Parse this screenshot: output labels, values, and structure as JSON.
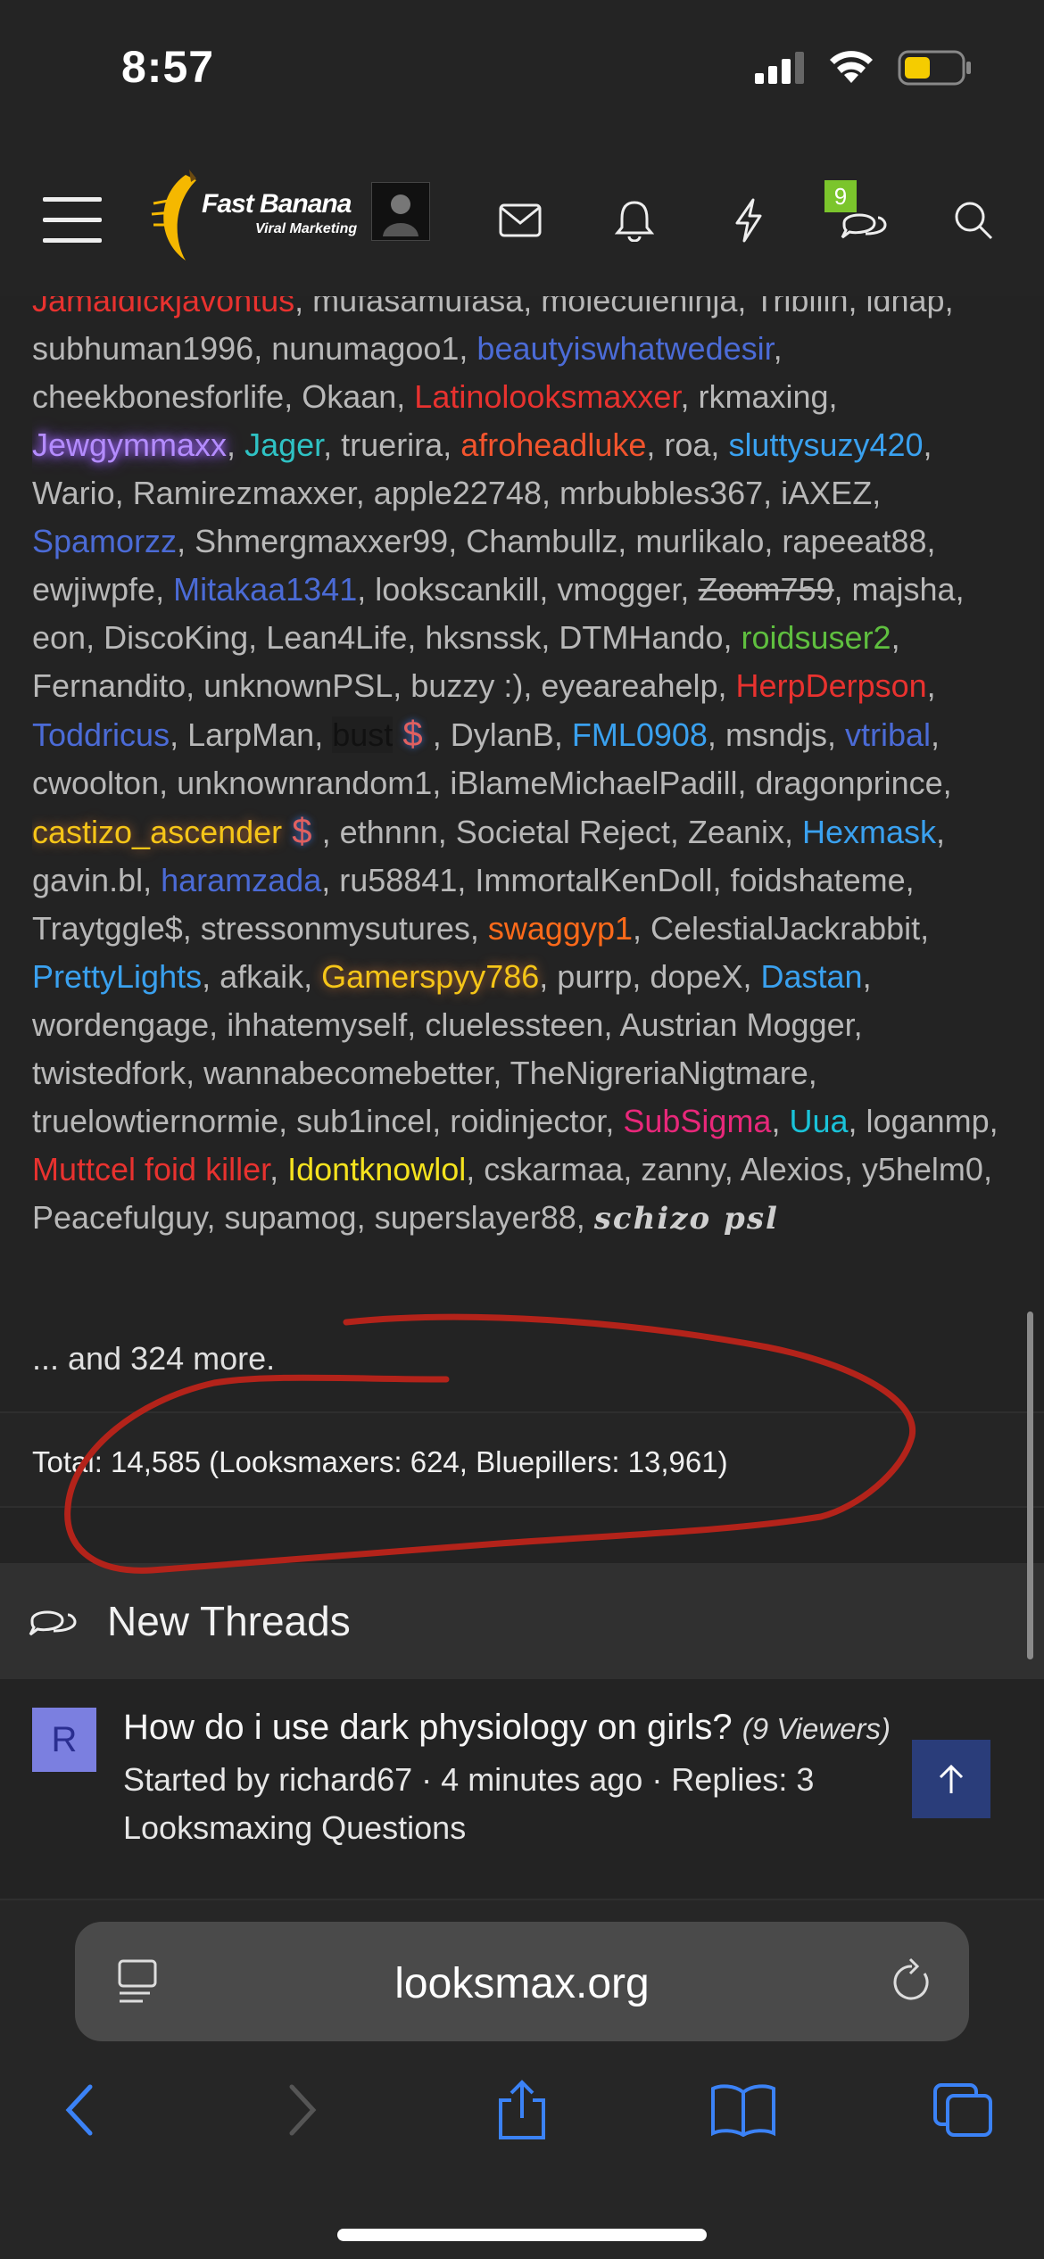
{
  "status_bar": {
    "time": "8:57"
  },
  "nav": {
    "logo_text": "Fast Banana",
    "logo_sub": "Viral Marketing",
    "chat_badge": "9"
  },
  "online": {
    "names": [
      {
        "t": "Jamaldickjavontus",
        "c": "red"
      },
      {
        "t": "mufasamufasa",
        "c": ""
      },
      {
        "t": "moleculeninja",
        "c": ""
      },
      {
        "t": "Tribilin",
        "c": ""
      },
      {
        "t": "idnap",
        "c": ""
      },
      {
        "t": "subhuman1996",
        "c": ""
      },
      {
        "t": "nunumagoo1",
        "c": ""
      },
      {
        "t": "beautyiswhatwedesir",
        "c": "blue"
      },
      {
        "t": "cheekbonesforlife",
        "c": ""
      },
      {
        "t": "Okaan",
        "c": ""
      },
      {
        "t": "Latinolooksmaxxer",
        "c": "red"
      },
      {
        "t": "rkmaxing",
        "c": ""
      },
      {
        "t": "Jewgymmaxx",
        "c": "purple"
      },
      {
        "t": "Jager",
        "c": "cyan"
      },
      {
        "t": "truerira",
        "c": ""
      },
      {
        "t": "afroheadluke",
        "c": "orangered"
      },
      {
        "t": "roa",
        "c": ""
      },
      {
        "t": "sluttysuzy420",
        "c": "sky"
      },
      {
        "t": "Wario",
        "c": ""
      },
      {
        "t": "Ramirezmaxxer",
        "c": ""
      },
      {
        "t": "apple22748",
        "c": ""
      },
      {
        "t": "mrbubbles367",
        "c": ""
      },
      {
        "t": "iAXEZ",
        "c": ""
      },
      {
        "t": "Spamorzz",
        "c": "blue"
      },
      {
        "t": "Shmergmaxxer99",
        "c": ""
      },
      {
        "t": "Chambullz",
        "c": ""
      },
      {
        "t": "murlikalo",
        "c": ""
      },
      {
        "t": "rapeeat88",
        "c": ""
      },
      {
        "t": "ewjiwpfe",
        "c": ""
      },
      {
        "t": "Mitakaa1341",
        "c": "blue"
      },
      {
        "t": "lookscankill",
        "c": ""
      },
      {
        "t": "vmogger",
        "c": ""
      },
      {
        "t": "Zoom759",
        "c": "strike"
      },
      {
        "t": "majsha",
        "c": ""
      },
      {
        "t": "eon",
        "c": ""
      },
      {
        "t": "DiscoKing",
        "c": ""
      },
      {
        "t": "Lean4Life",
        "c": ""
      },
      {
        "t": "hksnssk",
        "c": ""
      },
      {
        "t": "DTMHando",
        "c": ""
      },
      {
        "t": "roidsuser2",
        "c": "green"
      },
      {
        "t": "Fernandito",
        "c": ""
      },
      {
        "t": "unknownPSL",
        "c": ""
      },
      {
        "t": "buzzy :)",
        "c": ""
      },
      {
        "t": "eyeareahelp",
        "c": ""
      },
      {
        "t": "HerpDerpson",
        "c": "red"
      },
      {
        "t": "Toddricus",
        "c": "blue"
      },
      {
        "t": "LarpMan",
        "c": ""
      },
      {
        "t": "bust",
        "c": "dark",
        "dollar": true
      },
      {
        "t": "DylanB",
        "c": ""
      },
      {
        "t": "FML0908",
        "c": "sky"
      },
      {
        "t": "msndjs",
        "c": ""
      },
      {
        "t": "vtribal",
        "c": "blue"
      },
      {
        "t": "cwoolton",
        "c": ""
      },
      {
        "t": "unknownrandom1",
        "c": ""
      },
      {
        "t": "iBlameMichaelPadill",
        "c": ""
      },
      {
        "t": "dragonprince",
        "c": ""
      },
      {
        "t": "castizo_ascender",
        "c": "yellow",
        "dollar": true
      },
      {
        "t": "ethnnn",
        "c": ""
      },
      {
        "t": "Societal Reject",
        "c": ""
      },
      {
        "t": "Zeanix",
        "c": ""
      },
      {
        "t": "Hexmask",
        "c": "sky"
      },
      {
        "t": "gavin.bl",
        "c": ""
      },
      {
        "t": "haramzada",
        "c": "blue"
      },
      {
        "t": "ru58841",
        "c": ""
      },
      {
        "t": "ImmortalKenDoll",
        "c": ""
      },
      {
        "t": "foidshateme",
        "c": ""
      },
      {
        "t": "Traytggle$",
        "c": ""
      },
      {
        "t": "stressonmysutures",
        "c": ""
      },
      {
        "t": "swaggyp1",
        "c": "orange"
      },
      {
        "t": "CelestialJackrabbit",
        "c": ""
      },
      {
        "t": "PrettyLights",
        "c": "sky"
      },
      {
        "t": "afkaik",
        "c": ""
      },
      {
        "t": "Gamerspyy786",
        "c": "yellow"
      },
      {
        "t": "purrp",
        "c": ""
      },
      {
        "t": "dopeX",
        "c": ""
      },
      {
        "t": "Dastan",
        "c": "sky"
      },
      {
        "t": "wordengage",
        "c": ""
      },
      {
        "t": "ihhatemyself",
        "c": ""
      },
      {
        "t": "cluelessteen",
        "c": ""
      },
      {
        "t": "Austrian Mogger",
        "c": ""
      },
      {
        "t": "twistedfork",
        "c": ""
      },
      {
        "t": "wannabecomebetter",
        "c": ""
      },
      {
        "t": "TheNigreriaNigtmare",
        "c": ""
      },
      {
        "t": "truelowtiernormie",
        "c": ""
      },
      {
        "t": "sub1incel",
        "c": ""
      },
      {
        "t": "roidinjector",
        "c": ""
      },
      {
        "t": "SubSigma",
        "c": "pink"
      },
      {
        "t": "Uua",
        "c": "teal"
      },
      {
        "t": "loganmp",
        "c": ""
      },
      {
        "t": "Muttcel foid killer",
        "c": "red"
      },
      {
        "t": "Idontknowlol",
        "c": "gold"
      },
      {
        "t": "cskarmaa",
        "c": ""
      },
      {
        "t": "zanny",
        "c": ""
      },
      {
        "t": "Alexios",
        "c": ""
      },
      {
        "t": "y5helm0",
        "c": ""
      },
      {
        "t": "Peacefulguy",
        "c": ""
      },
      {
        "t": "supamog",
        "c": ""
      },
      {
        "t": "superslayer88",
        "c": ""
      },
      {
        "t": "schizo psl",
        "c": "gothic"
      }
    ],
    "more": "... and 324 more.",
    "total": "Total: 14,585 (Looksmaxers: 624, Bluepillers: 13,961)"
  },
  "new_threads": {
    "title": "New Threads",
    "threads": [
      {
        "avatar_letter": "R",
        "title": "How do i use dark physiology on girls?",
        "viewers": "(9 Viewers)",
        "meta": "Started by richard67 · 4 minutes ago · Replies: 3",
        "forum": "Looksmaxing Questions"
      }
    ]
  },
  "browser": {
    "url": "looksmax.org"
  },
  "colors": {
    "accent_blue": "#3b82f6",
    "badge_green": "#7bc52c",
    "annotation_red": "#b3231a"
  }
}
